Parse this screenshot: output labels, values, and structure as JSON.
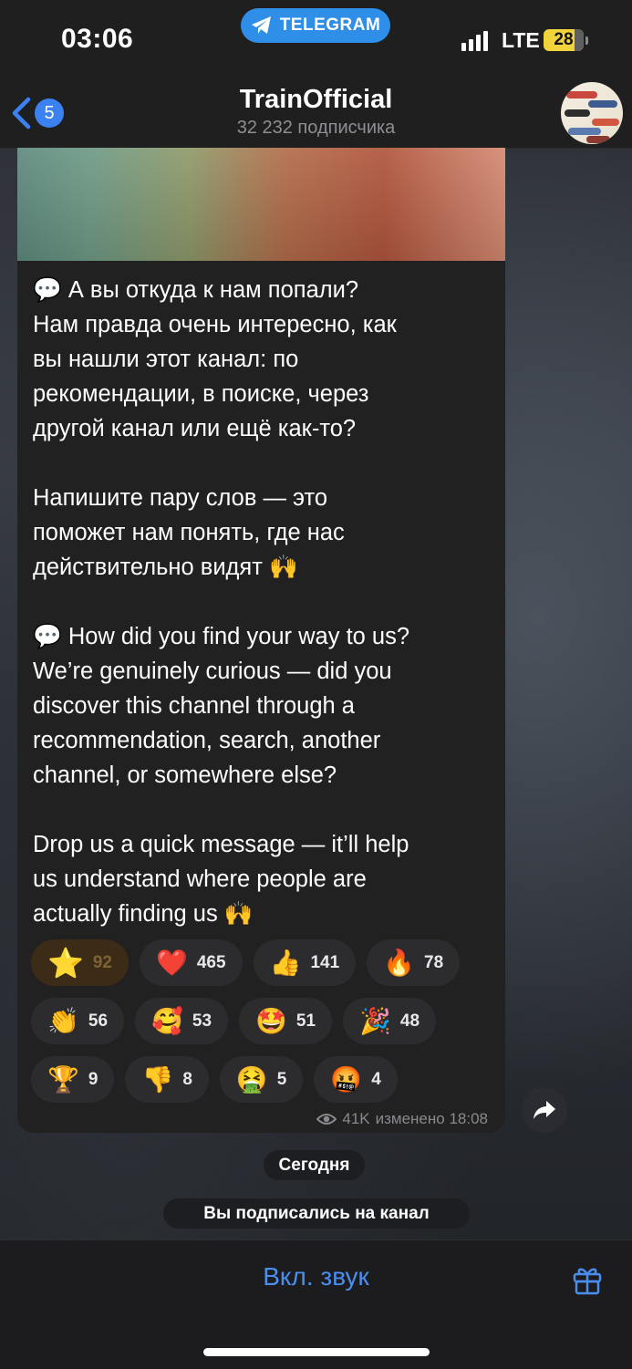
{
  "status_bar": {
    "time": "03:06",
    "app_pill": "TELEGRAM",
    "network": "LTE",
    "battery": "28"
  },
  "header": {
    "back_count": "5",
    "title": "TrainOfficial",
    "subtitle": "32 232 подписчика"
  },
  "message": {
    "text": "💬 А вы откуда к нам попали?\nНам правда очень интересно, как\nвы нашли этот канал: по\nрекомендации, в поиске, через\nдругой канал или ещё как-то?\n\nНапишите пару слов — это\nпоможет нам понять, где нас\nдействительно видят 🙌\n\n💬 How did you find your way to us?\nWe’re genuinely curious — did you\ndiscover this channel through a\nrecommendation, search, another\nchannel, or somewhere else?\n\nDrop us a quick message — it’ll help\nus understand where people are\nactually finding us 🙌",
    "views": "41K",
    "edited_time": "изменено 18:08"
  },
  "reactions": [
    [
      {
        "emoji": "⭐",
        "count": "92",
        "own": true
      },
      {
        "emoji": "❤️",
        "count": "465"
      },
      {
        "emoji": "👍",
        "count": "141"
      },
      {
        "emoji": "🔥",
        "count": "78"
      }
    ],
    [
      {
        "emoji": "👏",
        "count": "56"
      },
      {
        "emoji": "🥰",
        "count": "53"
      },
      {
        "emoji": "🤩",
        "count": "51"
      },
      {
        "emoji": "🎉",
        "count": "48"
      }
    ],
    [
      {
        "emoji": "🏆",
        "count": "9"
      },
      {
        "emoji": "👎",
        "count": "8"
      },
      {
        "emoji": "🤮",
        "count": "5"
      },
      {
        "emoji": "🤬",
        "count": "4"
      }
    ]
  ],
  "service": {
    "date": "Сегодня",
    "subscribed": "Вы подписались на канал"
  },
  "bottom": {
    "unmute_label": "Вкл. звук"
  },
  "icons": {
    "telegram": "telegram-plane-icon",
    "back": "chevron-left-icon",
    "views": "eye-icon",
    "share": "share-arrow-icon",
    "gift": "gift-icon"
  },
  "colors": {
    "accent": "#4a8ef0",
    "pill": "#2f8ee8",
    "battery": "#f1d33b"
  }
}
